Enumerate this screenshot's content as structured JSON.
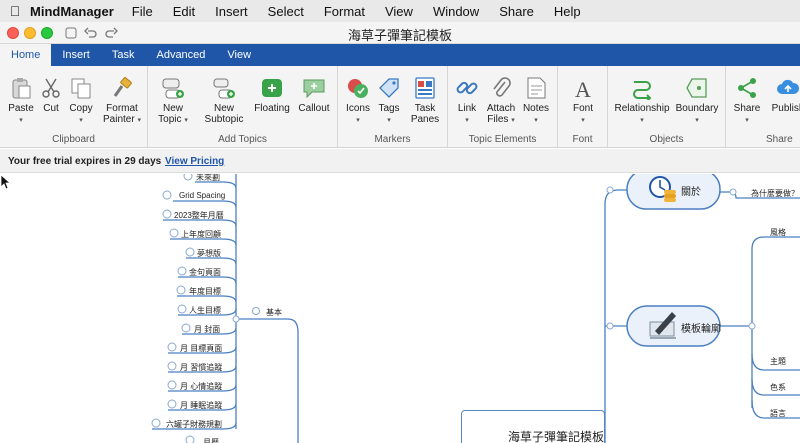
{
  "menubar": {
    "app_name": "MindManager",
    "menus": [
      "File",
      "Edit",
      "Insert",
      "Select",
      "Format",
      "View",
      "Window",
      "Share",
      "Help"
    ]
  },
  "window": {
    "title": "海草子彈筆記模板"
  },
  "ribbon_tabs": [
    "Home",
    "Insert",
    "Task",
    "Advanced",
    "View"
  ],
  "ribbon": {
    "clipboard": {
      "label": "Clipboard",
      "paste": "Paste",
      "cut": "Cut",
      "copy": "Copy",
      "format_painter_1": "Format",
      "format_painter_2": "Painter"
    },
    "add_topics": {
      "label": "Add Topics",
      "new_topic_1": "New",
      "new_topic_2": "Topic",
      "new_subtopic_1": "New",
      "new_subtopic_2": "Subtopic",
      "floating": "Floating",
      "callout": "Callout"
    },
    "markers": {
      "label": "Markers",
      "icons": "Icons",
      "tags": "Tags",
      "task_panes_1": "Task",
      "task_panes_2": "Panes"
    },
    "topic_elements": {
      "label": "Topic Elements",
      "link": "Link",
      "attach_1": "Attach",
      "attach_2": "Files",
      "notes": "Notes"
    },
    "font": {
      "label": "Font",
      "font": "Font"
    },
    "objects": {
      "label": "Objects",
      "relationship": "Relationship",
      "boundary": "Boundary"
    },
    "share": {
      "label": "Share",
      "share": "Share",
      "publish": "Publish"
    }
  },
  "trial": {
    "message": "Your free trial expires in 29 days",
    "link": "View Pricing"
  },
  "map": {
    "left_topics": [
      "未來劃",
      "Grid Spacing",
      "2023整年月曆",
      "上年度回顧",
      "夢想版",
      "金句頁面",
      "年度目標",
      "人生目標",
      "月 封面",
      "月 目標頁面",
      "月 習慣追蹤",
      "月 心情追蹤",
      "月 睡眠追蹤",
      "六罐子財務規劃",
      "月曆"
    ],
    "branch_label": "基本",
    "center": "海草子彈筆記模板",
    "right_topics": {
      "about": "關於",
      "about_sub": "為什麼要做？",
      "template": "模板輪廓",
      "style": "風格",
      "theme": "主題",
      "color": "色系",
      "language": "語言"
    }
  },
  "colors": {
    "ribbon_blue": "#1f56a8",
    "branch_blue": "#4a7fc0"
  }
}
